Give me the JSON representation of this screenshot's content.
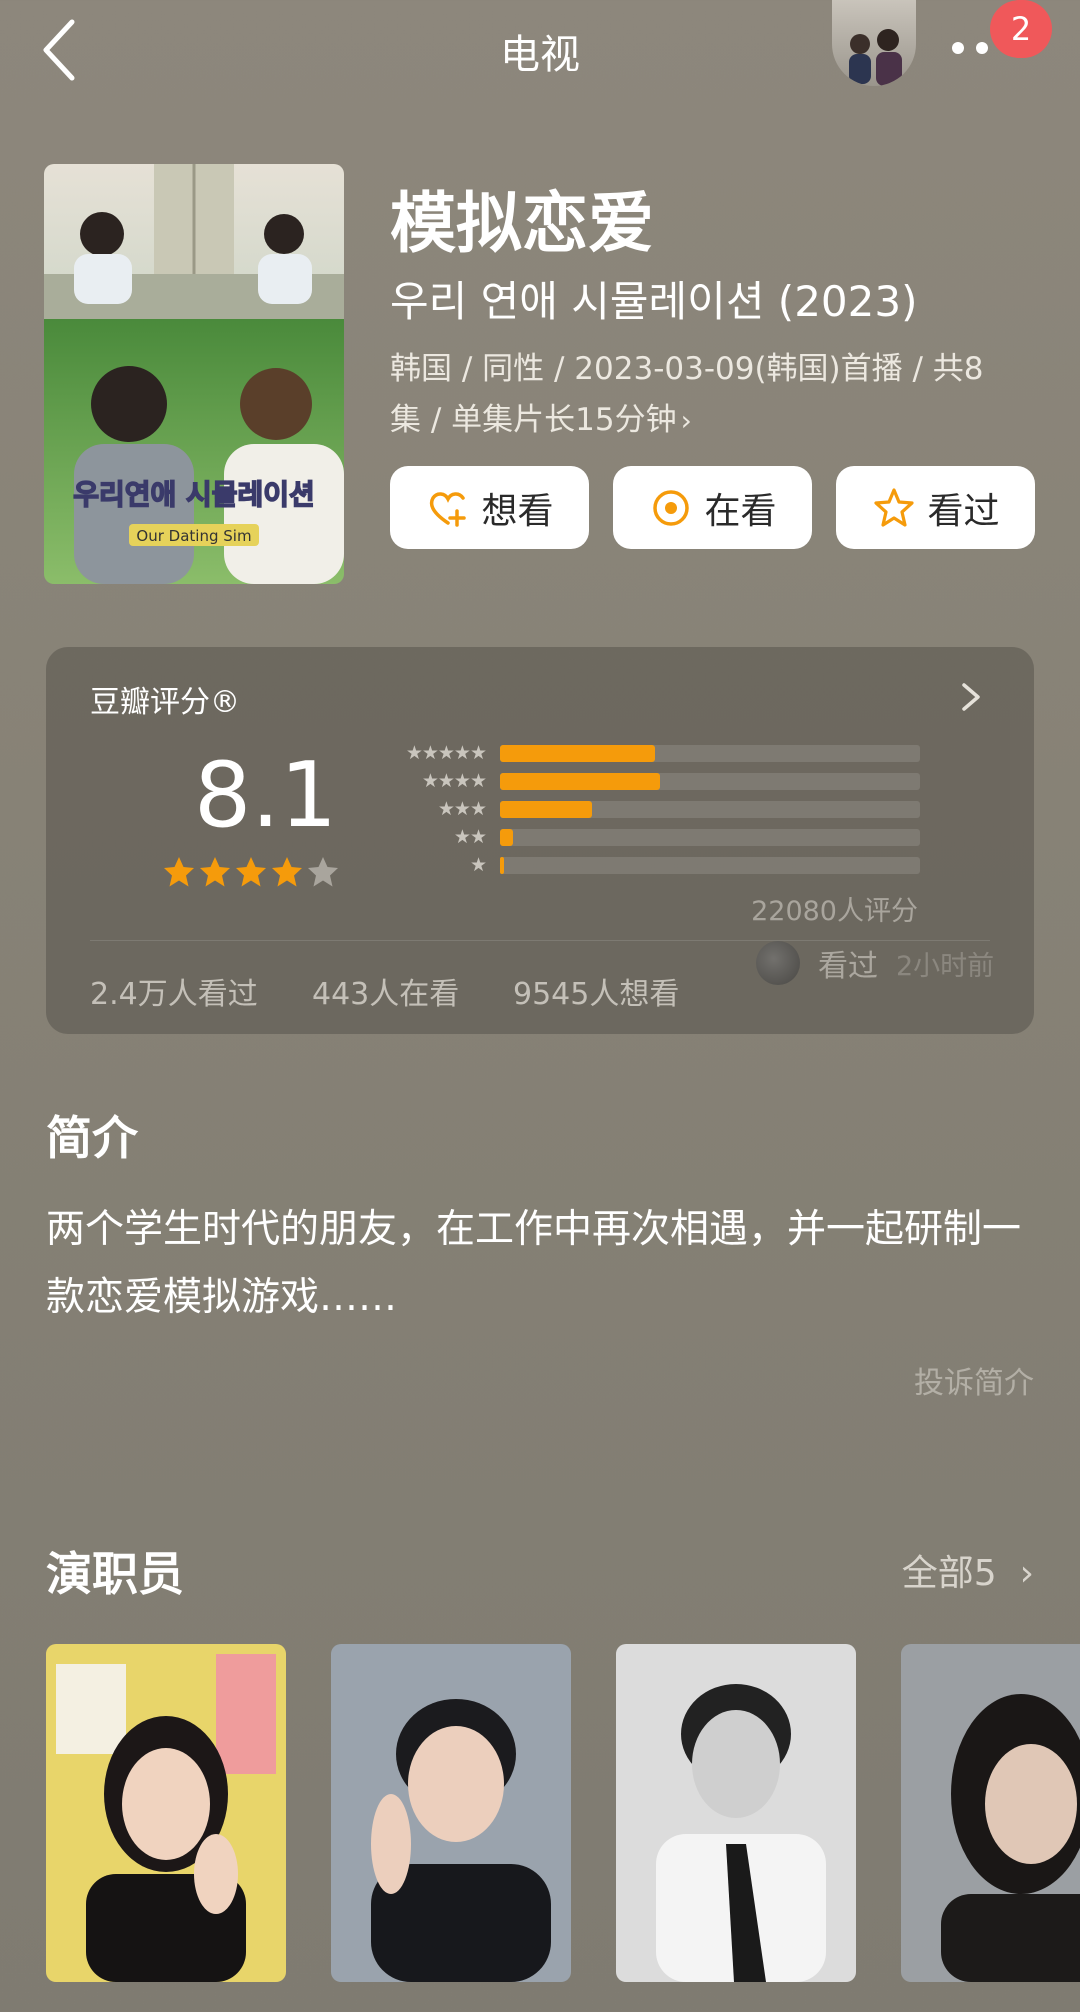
{
  "topbar": {
    "title": "电视",
    "badge_count": "2"
  },
  "show": {
    "title": "模拟恋爱",
    "original_title": "우리 연애 시뮬레이션 (2023)",
    "meta_line1": "韩国 / 同性 / 2023-03-09(韩国)首播 / 共8",
    "meta_line2": "集 / 单集片长15分钟",
    "poster_text": "우리연애 시뮬레이션",
    "poster_subtext": "Our Dating Sim"
  },
  "actions": {
    "want": "想看",
    "watching": "在看",
    "watched": "看过"
  },
  "rating": {
    "label": "豆瓣评分®",
    "score": "8.1",
    "stars": 4,
    "distribution": [
      {
        "stars": "★★★★★",
        "fraction": 0.37
      },
      {
        "stars": "★★★★",
        "fraction": 0.38
      },
      {
        "stars": "★★★",
        "fraction": 0.22
      },
      {
        "stars": "★★",
        "fraction": 0.03
      },
      {
        "stars": "★",
        "fraction": 0.01
      }
    ],
    "count_text": "22080人评分",
    "watched_text": "2.4万人看过",
    "watching_text": "443人在看",
    "want_text": "9545人想看",
    "friend_action": "看过",
    "friend_time": "2小时前"
  },
  "intro": {
    "title": "简介",
    "text": "两个学生时代的朋友，在工作中再次相遇，并一起研制一款恋爱模拟游戏……",
    "report": "投诉简介"
  },
  "cast": {
    "title": "演职员",
    "all_label": "全部5",
    "members": [
      {
        "name": ""
      },
      {
        "name": ""
      },
      {
        "name": ""
      },
      {
        "name": ""
      }
    ]
  },
  "colors": {
    "accent": "#f59b0b",
    "badge": "#f0585a",
    "background": "#878276"
  }
}
